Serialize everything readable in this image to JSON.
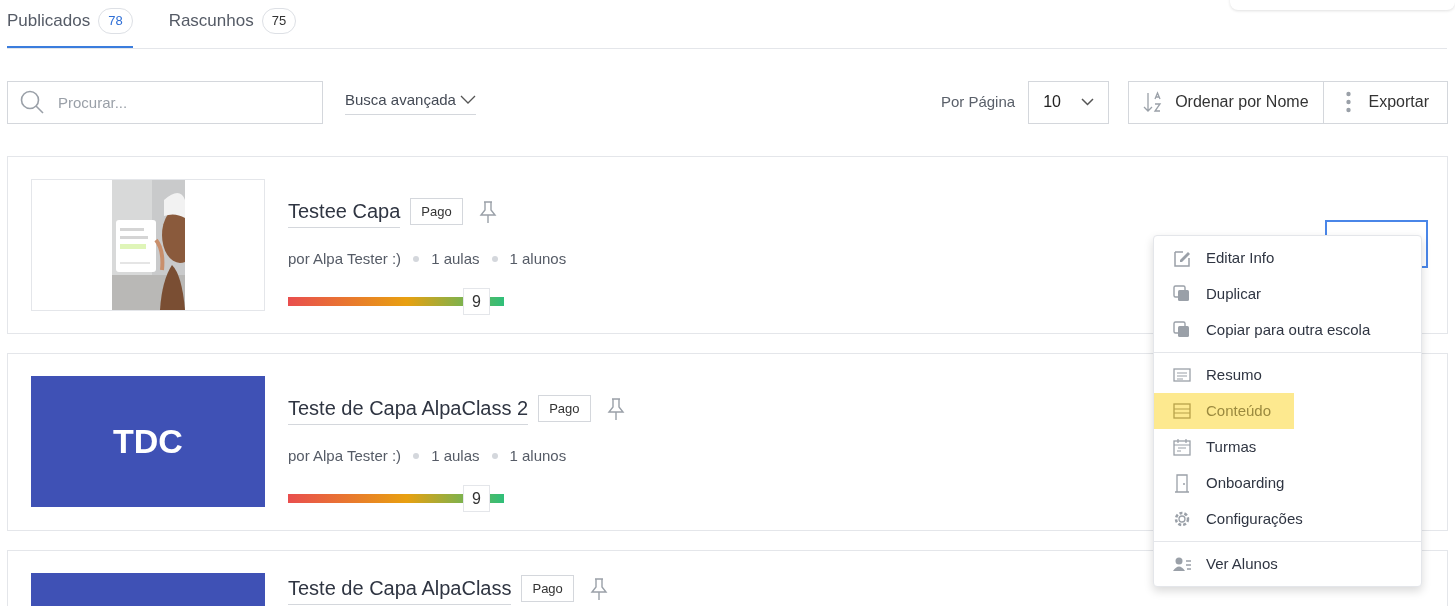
{
  "tabs": [
    {
      "label": "Publicados",
      "count": "78",
      "selected": true
    },
    {
      "label": "Rascunhos",
      "count": "75",
      "selected": false
    }
  ],
  "toolbar": {
    "search": {
      "placeholder": "Procurar..."
    },
    "advanced_search": "Busca avançada",
    "per_page_label": "Por Página",
    "per_page_value": "10",
    "sort_button": "Ordenar por Nome",
    "export_button": "Exportar"
  },
  "courses": [
    {
      "title": "Testee Capa",
      "badge": "Pago",
      "author": "por Alpa Tester :)",
      "lessons": "1 aulas",
      "students": "1 alunos",
      "score": "9",
      "level": 0.87
    },
    {
      "title": "Teste de Capa AlpaClass 2",
      "badge": "Pago",
      "author": "por Alpa Tester :)",
      "lessons": "1 aulas",
      "students": "1 alunos",
      "score": "9",
      "level": 0.87,
      "cover": {
        "kind": "initials",
        "text": "TDC"
      }
    },
    {
      "title": "Teste de Capa AlpaClass",
      "badge": "Pago",
      "cover": {
        "kind": "initials"
      }
    }
  ],
  "menu": {
    "groups": [
      [
        {
          "label": "Editar Info",
          "selected": false
        },
        {
          "label": "Duplicar",
          "selected": false
        },
        {
          "label": "Copiar para outra escola",
          "selected": false
        }
      ],
      [
        {
          "label": "Resumo",
          "selected": false
        },
        {
          "label": "Conteúdo",
          "selected": true
        },
        {
          "label": "Turmas",
          "selected": false
        },
        {
          "label": "Onboarding",
          "selected": false
        },
        {
          "label": "Configurações",
          "selected": false
        }
      ],
      [
        {
          "label": "Ver Alunos",
          "selected": false
        }
      ]
    ]
  }
}
